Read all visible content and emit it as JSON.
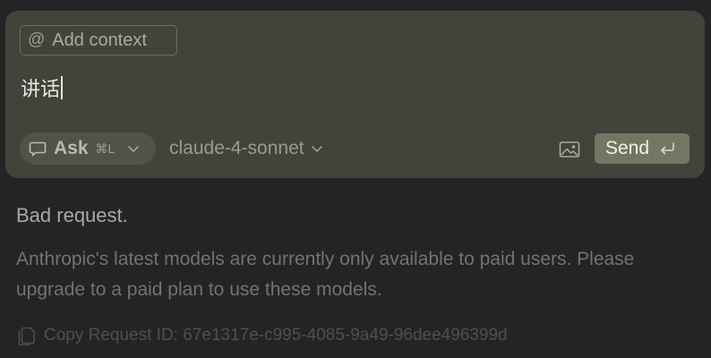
{
  "composer": {
    "context_chip": {
      "icon": "at-icon",
      "label": "Add context"
    },
    "input": {
      "value": "讲话"
    },
    "mode": {
      "icon": "chat-bubble-icon",
      "label": "Ask",
      "shortcut": "⌘L"
    },
    "model": {
      "value": "claude-4-sonnet"
    },
    "image_button": {
      "icon": "image-icon"
    },
    "send": {
      "label": "Send",
      "icon": "enter-icon",
      "color": "#747563"
    }
  },
  "error": {
    "title": "Bad request.",
    "message": "Anthropic's latest models are currently only available to paid users. Please upgrade to a paid plan to use these models.",
    "copy_label": "Copy Request ID: 67e1317e-c995-4085-9a49-96dee496399d",
    "copy_icon": "copy-icon"
  },
  "colors": {
    "background": "#242424",
    "composer_background": "#42433a"
  }
}
